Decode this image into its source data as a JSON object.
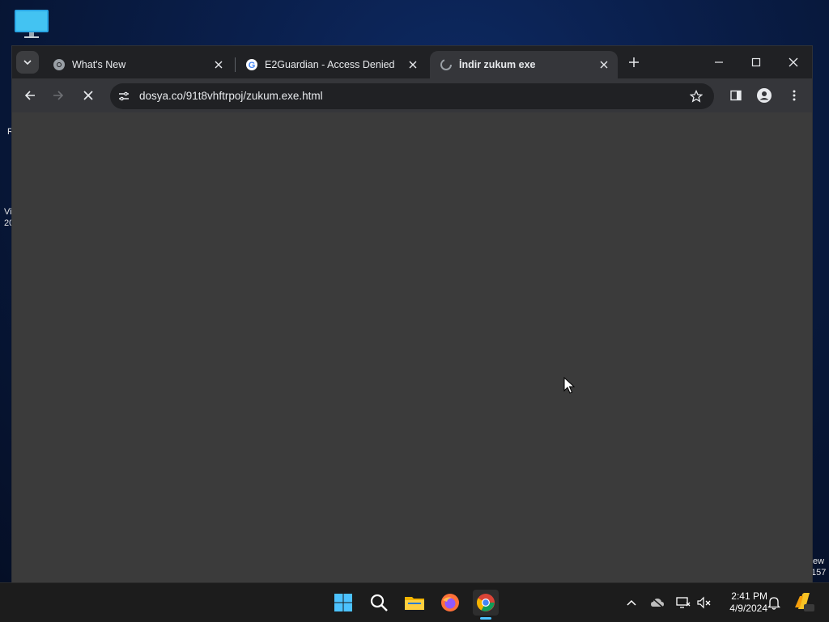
{
  "browser": {
    "tabs": [
      {
        "title": "What's New",
        "favicon": "chrome-icon",
        "active": false
      },
      {
        "title": "E2Guardian - Access Denied",
        "favicon": "google-icon",
        "active": false
      },
      {
        "title": "İndir zukum exe",
        "favicon": "loading-spinner-icon",
        "active": true
      }
    ],
    "url": "dosya.co/91t8vhftrpoj/zukum.exe.html"
  },
  "desktop": {
    "edge_text_left": [
      "R",
      "Vi",
      "20"
    ],
    "edge_text_right": [
      "ew",
      "157"
    ]
  },
  "taskbar": {
    "apps": [
      "windows-start-icon",
      "search-icon",
      "file-explorer-icon",
      "firefox-icon",
      "chrome-icon"
    ],
    "clock_time": "2:41 PM",
    "clock_date": "4/9/2024"
  },
  "colors": {
    "chrome_dark": "#202124",
    "toolbar": "#35363a",
    "content": "#3b3b3b",
    "accent": "#4cc2ff"
  }
}
